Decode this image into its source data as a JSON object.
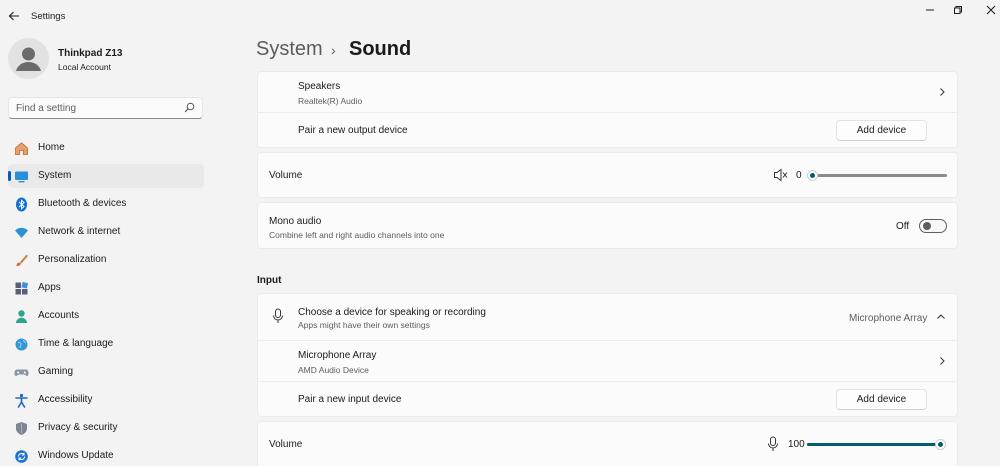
{
  "window": {
    "title": "Settings"
  },
  "profile": {
    "name": "Thinkpad Z13",
    "account": "Local Account"
  },
  "search": {
    "placeholder": "Find a setting"
  },
  "nav": [
    {
      "label": "Home",
      "icon": "home-icon"
    },
    {
      "label": "System",
      "icon": "system-icon",
      "active": true
    },
    {
      "label": "Bluetooth & devices",
      "icon": "bluetooth-icon"
    },
    {
      "label": "Network & internet",
      "icon": "wifi-icon"
    },
    {
      "label": "Personalization",
      "icon": "brush-icon"
    },
    {
      "label": "Apps",
      "icon": "apps-icon"
    },
    {
      "label": "Accounts",
      "icon": "accounts-icon"
    },
    {
      "label": "Time & language",
      "icon": "globe-icon"
    },
    {
      "label": "Gaming",
      "icon": "gamepad-icon"
    },
    {
      "label": "Accessibility",
      "icon": "accessibility-icon"
    },
    {
      "label": "Privacy & security",
      "icon": "shield-icon"
    },
    {
      "label": "Windows Update",
      "icon": "update-icon"
    }
  ],
  "breadcrumb": {
    "root": "System",
    "separator": "›",
    "page": "Sound"
  },
  "output": {
    "device_name": "Speakers",
    "device_sub": "Realtek(R) Audio",
    "pair_label": "Pair a new output device",
    "add_device_label": "Add device",
    "volume_label": "Volume",
    "volume_value": "0",
    "volume_level": 0,
    "mono_title": "Mono audio",
    "mono_sub": "Combine left and right audio channels into one",
    "mono_state": "Off"
  },
  "input": {
    "section_title": "Input",
    "choose_title": "Choose a device for speaking or recording",
    "choose_sub": "Apps might have their own settings",
    "selected_device": "Microphone Array",
    "device_name": "Microphone Array",
    "device_sub": "AMD Audio Device",
    "pair_label": "Pair a new input device",
    "add_device_label": "Add device",
    "volume_label": "Volume",
    "volume_value": "100",
    "volume_level": 100
  },
  "colors": {
    "accent": "#005f6b",
    "nav_indicator": "#005fb8",
    "background": "#f3f3f3",
    "card": "#fbfbfb"
  }
}
